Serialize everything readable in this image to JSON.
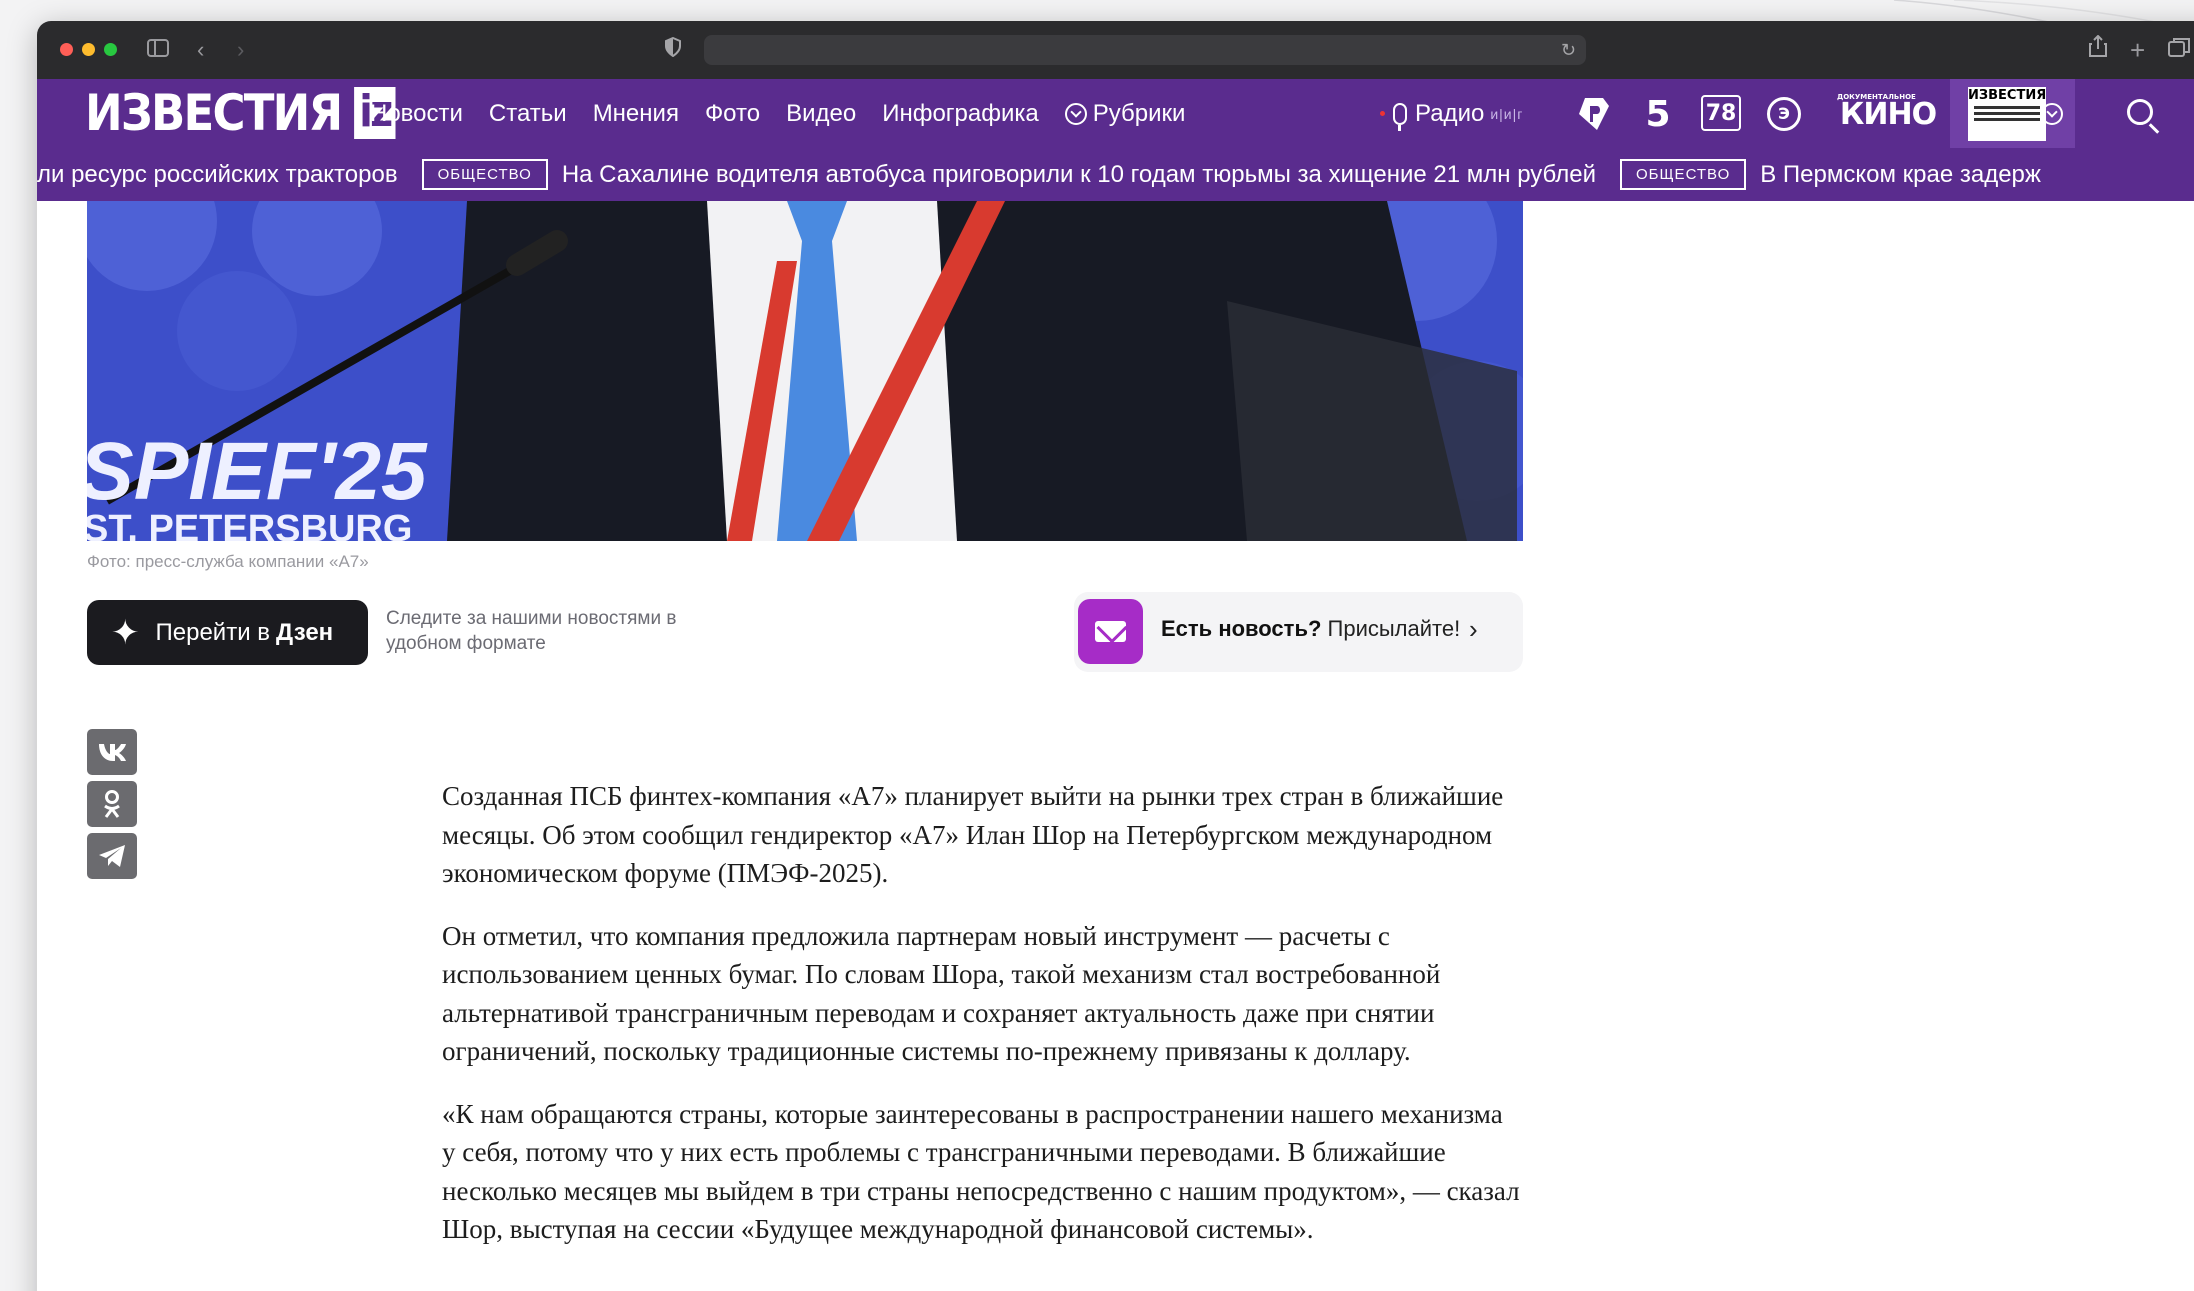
{
  "site": {
    "logo_text": "ИЗВЕСТИЯ",
    "logo_badge": "iz",
    "nav": [
      "Новости",
      "Статьи",
      "Мнения",
      "Фото",
      "Видео",
      "Инфографика"
    ],
    "rubrics_label": "Рубрики",
    "radio_label": "Радио",
    "radio_freq": "и|и|г",
    "channels": {
      "ch5": "5",
      "ch78": "78",
      "kino_top": "ДОКУМЕНТАЛЬНОЕ",
      "kino": "КИНО"
    },
    "paper_label": "ИЗВЕСТИЯ"
  },
  "ticker": [
    {
      "tag": "",
      "text": "ли ресурс российских тракторов"
    },
    {
      "tag": "ОБЩЕСТВО",
      "text": "На Сахалине водителя автобуса приговорили к 10 годам тюрьмы за хищение 21 млн рублей"
    },
    {
      "tag": "ОБЩЕСТВО",
      "text": "В Пермском крае задерж"
    }
  ],
  "hero": {
    "badge_line1": "SPIEF'25",
    "badge_line2": "ST. PETERSBURG"
  },
  "article": {
    "photo_caption": "Фото: пресс-служба компании «А7»",
    "dzen_button": "Перейти в",
    "dzen_brand": "Дзен",
    "dzen_note": "Следите за нашими новостями в удобном формате",
    "news_bold": "Есть новость?",
    "news_text": "Присылайте!",
    "share": {
      "vk": "VK",
      "ok": "OK",
      "tg": "TG"
    },
    "paragraphs": [
      "Созданная ПСБ финтех-компания «А7» планирует выйти на рынки трех стран в ближайшие месяцы. Об этом сообщил гендиректор «А7» Илан Шор на Петербургском международном экономическом форуме (ПМЭФ-2025).",
      "Он отметил, что компания предложила партнерам новый инструмент — расчеты с использованием ценных бумаг. По словам Шора, такой механизм стал востребованной альтернативой трансграничным переводам и сохраняет актуальность даже при снятии ограничений, поскольку традиционные системы по-прежнему привязаны к доллару.",
      "«К нам обращаются страны, которые заинтересованы в распространении нашего механизма у себя, потому что у них есть проблемы с трансграничными переводами. В ближайшие несколько месяцев мы выйдем в три страны непосредственно с нашим продуктом», — сказал Шор, выступая на сессии «Будущее международной финансовой системы»."
    ]
  },
  "colors": {
    "brand": "#5a2c8e",
    "accent": "#a62cc7"
  }
}
